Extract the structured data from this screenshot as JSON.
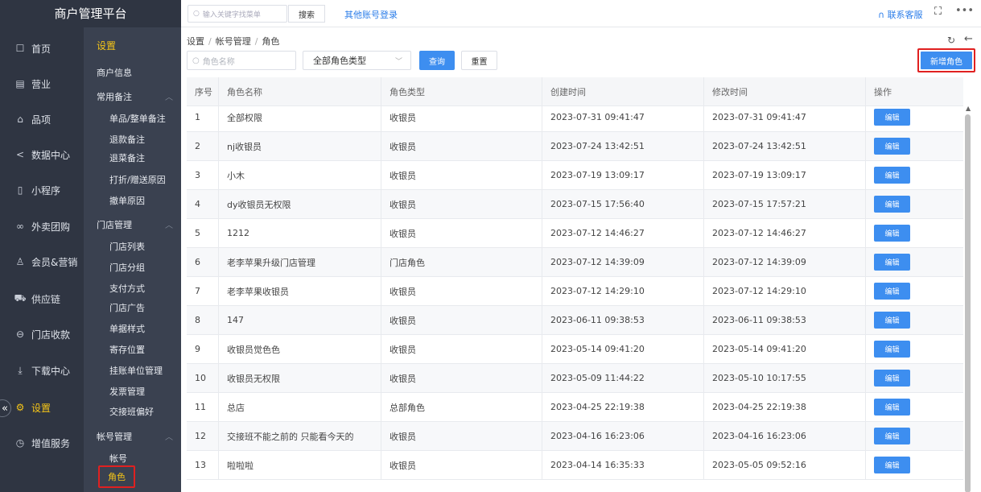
{
  "brand": "商户管理平台",
  "main_nav": [
    {
      "label": "首页",
      "icon": "home-icon",
      "glyph": "☐"
    },
    {
      "label": "营业",
      "icon": "register-icon",
      "glyph": "▤"
    },
    {
      "label": "品项",
      "icon": "bag-icon",
      "glyph": "⌂"
    },
    {
      "label": "数据中心",
      "icon": "share-icon",
      "glyph": "<"
    },
    {
      "label": "小程序",
      "icon": "phone-icon",
      "glyph": "▯"
    },
    {
      "label": "外卖团购",
      "icon": "delivery-icon",
      "glyph": "∞"
    },
    {
      "label": "会员&营销",
      "icon": "user-icon",
      "glyph": "♙"
    },
    {
      "label": "供应链",
      "icon": "truck-icon",
      "glyph": "⛟"
    },
    {
      "label": "门店收款",
      "icon": "wallet-icon",
      "glyph": "⊖"
    },
    {
      "label": "下载中心",
      "icon": "download-icon",
      "glyph": "⤓"
    },
    {
      "label": "设置",
      "icon": "gear-icon",
      "glyph": "⚙"
    },
    {
      "label": "增值服务",
      "icon": "clock-icon",
      "glyph": "◷"
    }
  ],
  "sub_nav": {
    "title": "设置",
    "merchant_info": "商户信息",
    "groups": [
      {
        "label": "常用备注",
        "items": [
          "单品/整单备注",
          "退款备注",
          "退菜备注",
          "打折/赠送原因",
          "撤单原因"
        ]
      },
      {
        "label": "门店管理",
        "items": [
          "门店列表",
          "门店分组",
          "支付方式",
          "门店广告",
          "单据样式",
          "寄存位置",
          "挂账单位管理",
          "发票管理",
          "交接班偏好"
        ]
      },
      {
        "label": "帐号管理",
        "items": [
          "帐号",
          "角色"
        ]
      }
    ]
  },
  "topbar": {
    "search_placeholder": "输入关键字找菜单",
    "search_button": "搜索",
    "other_login": "其他账号登录",
    "contact": "联系客服"
  },
  "breadcrumb": [
    "设置",
    "帐号管理",
    "角色"
  ],
  "filters": {
    "role_name_placeholder": "角色名称",
    "role_type_selected": "全部角色类型",
    "query_label": "查询",
    "reset_label": "重置",
    "add_role_label": "新增角色"
  },
  "table": {
    "headers": [
      "序号",
      "角色名称",
      "角色类型",
      "创建时间",
      "修改时间",
      "操作"
    ],
    "edit_label": "编辑",
    "rows": [
      [
        "1",
        "全部权限",
        "收银员",
        "2023-07-31 09:41:47",
        "2023-07-31 09:41:47"
      ],
      [
        "2",
        "nj收银员",
        "收银员",
        "2023-07-24 13:42:51",
        "2023-07-24 13:42:51"
      ],
      [
        "3",
        "小木",
        "收银员",
        "2023-07-19 13:09:17",
        "2023-07-19 13:09:17"
      ],
      [
        "4",
        "dy收银员无权限",
        "收银员",
        "2023-07-15 17:56:40",
        "2023-07-15 17:57:21"
      ],
      [
        "5",
        "1212",
        "收银员",
        "2023-07-12 14:46:27",
        "2023-07-12 14:46:27"
      ],
      [
        "6",
        "老李苹果升级门店管理",
        "门店角色",
        "2023-07-12 14:39:09",
        "2023-07-12 14:39:09"
      ],
      [
        "7",
        "老李苹果收银员",
        "收银员",
        "2023-07-12 14:29:10",
        "2023-07-12 14:29:10"
      ],
      [
        "8",
        "147",
        "收银员",
        "2023-06-11 09:38:53",
        "2023-06-11 09:38:53"
      ],
      [
        "9",
        "收银员觉色色",
        "收银员",
        "2023-05-14 09:41:20",
        "2023-05-14 09:41:20"
      ],
      [
        "10",
        "收银员无权限",
        "收银员",
        "2023-05-09 11:44:22",
        "2023-05-10 10:17:55"
      ],
      [
        "11",
        "总店",
        "总部角色",
        "2023-04-25 22:19:38",
        "2023-04-25 22:19:38"
      ],
      [
        "12",
        "交接班不能之前的 只能看今天的",
        "收银员",
        "2023-04-16 16:23:06",
        "2023-04-16 16:23:06"
      ],
      [
        "13",
        "啦啦啦",
        "收银员",
        "2023-04-14 16:35:33",
        "2023-05-05 09:52:16"
      ]
    ]
  },
  "colors": {
    "accent": "#3d8ef0",
    "nav_bg": "#2f3542",
    "active": "#f5c518",
    "highlight": "#e02020"
  }
}
